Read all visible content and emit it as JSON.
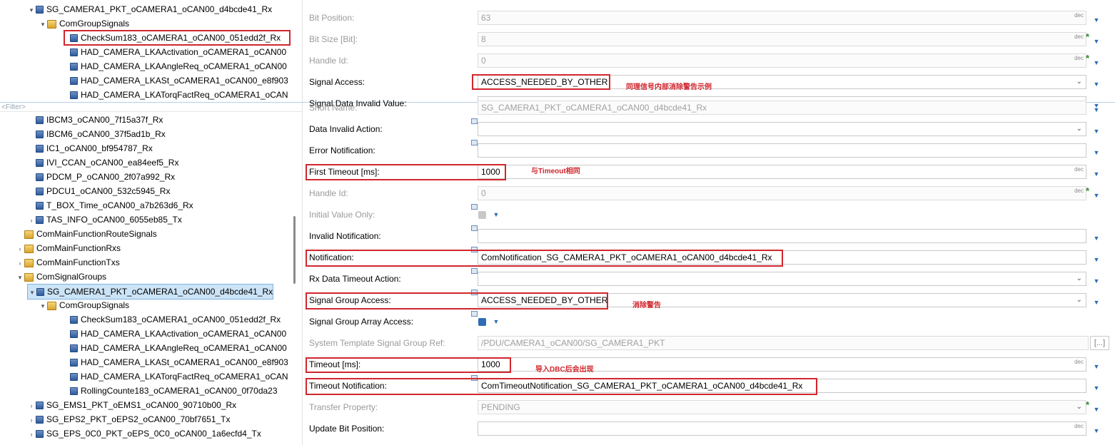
{
  "tree_top": [
    {
      "label": "SG_CAMERA1_PKT_oCAMERA1_oCAN00_d4bcde41_Rx",
      "indent": 54,
      "arrow": "▾",
      "icon": "sig"
    },
    {
      "label": "ComGroupSignals",
      "indent": 70,
      "arrow": "▾",
      "icon": "folder"
    },
    {
      "label": "CheckSum183_oCAMERA1_oCAN00_051edd2f_Rx",
      "indent": 102,
      "arrow": "",
      "icon": "sig",
      "selected": true
    },
    {
      "label": "HAD_CAMERA_LKAActivation_oCAMERA1_oCAN00",
      "indent": 102,
      "arrow": "",
      "icon": "sig"
    },
    {
      "label": "HAD_CAMERA_LKAAngleReq_oCAMERA1_oCAN00",
      "indent": 102,
      "arrow": "",
      "icon": "sig"
    },
    {
      "label": "HAD_CAMERA_LKASt_oCAMERA1_oCAN00_e8f903",
      "indent": 102,
      "arrow": "",
      "icon": "sig"
    },
    {
      "label": "HAD_CAMERA_LKATorqFactReq_oCAMERA1_oCAN",
      "indent": 102,
      "arrow": "",
      "icon": "sig"
    }
  ],
  "filter_placeholder": "<Filter>",
  "tree_bottom": [
    {
      "label": "IBCM3_oCAN00_7f15a37f_Rx",
      "indent": 54,
      "arrow": "",
      "icon": "sig"
    },
    {
      "label": "IBCM6_oCAN00_37f5ad1b_Rx",
      "indent": 54,
      "arrow": "",
      "icon": "sig"
    },
    {
      "label": "IC1_oCAN00_bf954787_Rx",
      "indent": 54,
      "arrow": "",
      "icon": "sig"
    },
    {
      "label": "IVI_CCAN_oCAN00_ea84eef5_Rx",
      "indent": 54,
      "arrow": "",
      "icon": "sig"
    },
    {
      "label": "PDCM_P_oCAN00_2f07a992_Rx",
      "indent": 54,
      "arrow": "",
      "icon": "sig"
    },
    {
      "label": "PDCU1_oCAN00_532c5945_Rx",
      "indent": 54,
      "arrow": "",
      "icon": "sig"
    },
    {
      "label": "T_BOX_Time_oCAN00_a7b263d6_Rx",
      "indent": 54,
      "arrow": "",
      "icon": "sig"
    },
    {
      "label": "TAS_INFO_oCAN00_6055eb85_Tx",
      "indent": 54,
      "arrow": "›",
      "icon": "sig"
    },
    {
      "label": "ComMainFunctionRouteSignals",
      "indent": 38,
      "arrow": "",
      "icon": "folder"
    },
    {
      "label": "ComMainFunctionRxs",
      "indent": 38,
      "arrow": "›",
      "icon": "folder"
    },
    {
      "label": "ComMainFunctionTxs",
      "indent": 38,
      "arrow": "›",
      "icon": "folder"
    },
    {
      "label": "ComSignalGroups",
      "indent": 38,
      "arrow": "▾",
      "icon": "folder"
    },
    {
      "label": "SG_CAMERA1_PKT_oCAMERA1_oCAN00_d4bcde41_Rx",
      "indent": 54,
      "arrow": "▾",
      "icon": "sig",
      "selected": true
    },
    {
      "label": "ComGroupSignals",
      "indent": 70,
      "arrow": "▾",
      "icon": "folder"
    },
    {
      "label": "CheckSum183_oCAMERA1_oCAN00_051edd2f_Rx",
      "indent": 102,
      "arrow": "",
      "icon": "sig"
    },
    {
      "label": "HAD_CAMERA_LKAActivation_oCAMERA1_oCAN00",
      "indent": 102,
      "arrow": "",
      "icon": "sig"
    },
    {
      "label": "HAD_CAMERA_LKAAngleReq_oCAMERA1_oCAN00",
      "indent": 102,
      "arrow": "",
      "icon": "sig"
    },
    {
      "label": "HAD_CAMERA_LKASt_oCAMERA1_oCAN00_e8f903",
      "indent": 102,
      "arrow": "",
      "icon": "sig"
    },
    {
      "label": "HAD_CAMERA_LKATorqFactReq_oCAMERA1_oCAN",
      "indent": 102,
      "arrow": "",
      "icon": "sig"
    },
    {
      "label": "RollingCounte183_oCAMERA1_oCAN00_0f70da23",
      "indent": 102,
      "arrow": "",
      "icon": "sig"
    },
    {
      "label": "SG_EMS1_PKT_oEMS1_oCAN00_90710b00_Rx",
      "indent": 54,
      "arrow": "›",
      "icon": "sig"
    },
    {
      "label": "SG_EPS2_PKT_oEPS2_oCAN00_70bf7651_Tx",
      "indent": 54,
      "arrow": "›",
      "icon": "sig"
    },
    {
      "label": "SG_EPS_0C0_PKT_oEPS_0C0_oCAN00_1a6ecfd4_Tx",
      "indent": 54,
      "arrow": "›",
      "icon": "sig"
    }
  ],
  "upper_props": [
    {
      "label": "Bit Position:",
      "value": "63",
      "disabled": true,
      "dec": "dec"
    },
    {
      "label": "Bit Size [Bit]:",
      "value": "8",
      "disabled": true,
      "dec": "dec",
      "star": true
    },
    {
      "label": "Handle Id:",
      "value": "0",
      "disabled": true,
      "dec": "dec",
      "star": true
    },
    {
      "label": "Signal Access:",
      "value": "ACCESS_NEEDED_BY_OTHER",
      "disabled": false,
      "dropdown": true
    },
    {
      "label": "Signal Data Invalid Value:",
      "value": "",
      "disabled": false
    }
  ],
  "props": [
    {
      "label": "Short Name:",
      "value": "SG_CAMERA1_PKT_oCAMERA1_oCAN00_d4bcde41_Rx",
      "disabled": true
    },
    {
      "label": "Data Invalid Action:",
      "value": "",
      "disabled": false,
      "dropdown": true
    },
    {
      "label": "Error Notification:",
      "value": "",
      "disabled": false
    },
    {
      "label": "First Timeout [ms]:",
      "value": "1000",
      "disabled": false,
      "dec": "dec"
    },
    {
      "label": "Handle Id:",
      "value": "0",
      "disabled": true,
      "dec": "dec",
      "star": true
    },
    {
      "label": "Initial Value Only:",
      "value": "",
      "disabled": true,
      "checkbox": "grey"
    },
    {
      "label": "Invalid Notification:",
      "value": "",
      "disabled": false
    },
    {
      "label": "Notification:",
      "value": "ComNotification_SG_CAMERA1_PKT_oCAMERA1_oCAN00_d4bcde41_Rx",
      "disabled": false
    },
    {
      "label": "Rx Data Timeout Action:",
      "value": "",
      "disabled": false,
      "dropdown": true
    },
    {
      "label": "Signal Group Access:",
      "value": "ACCESS_NEEDED_BY_OTHER",
      "disabled": false,
      "dropdown": true
    },
    {
      "label": "Signal Group Array Access:",
      "value": "",
      "disabled": false,
      "checkbox": "blue"
    },
    {
      "label": "System Template Signal Group Ref:",
      "value": "/PDU/CAMERA1_oCAN00/SG_CAMERA1_PKT",
      "disabled": true,
      "ellipsis": "[...]"
    },
    {
      "label": "Timeout [ms]:",
      "value": "1000",
      "disabled": false,
      "dec": "dec"
    },
    {
      "label": "Timeout Notification:",
      "value": "ComTimeoutNotification_SG_CAMERA1_PKT_oCAMERA1_oCAN00_d4bcde41_Rx",
      "disabled": false
    },
    {
      "label": "Transfer Property:",
      "value": "PENDING",
      "disabled": true,
      "dropdown": true,
      "star": true
    },
    {
      "label": "Update Bit Position:",
      "value": "",
      "disabled": false,
      "dec": "dec"
    }
  ],
  "annotations": {
    "signal_access": "同理信号内部消除警告示例",
    "first_timeout": "与Timeout相同",
    "signal_group_access": "消除警告",
    "timeout": "导入DBC后会出现"
  }
}
